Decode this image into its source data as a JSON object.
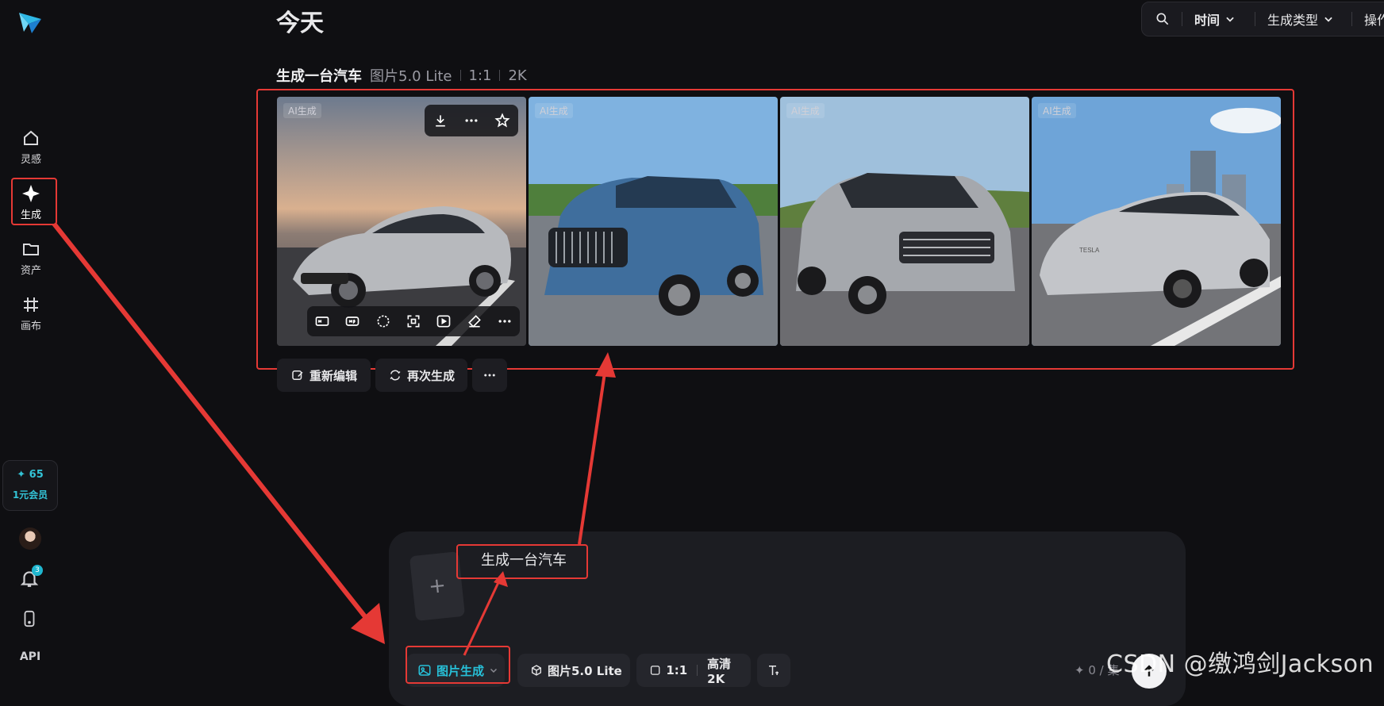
{
  "sidebar": {
    "items": [
      {
        "label": "灵感",
        "icon": "home-icon"
      },
      {
        "label": "生成",
        "icon": "sparkle-icon"
      },
      {
        "label": "资产",
        "icon": "folder-icon"
      },
      {
        "label": "画布",
        "icon": "canvas-icon"
      }
    ],
    "credits": "65",
    "membership": "1元会员",
    "notification_count": "3",
    "api_label": "API"
  },
  "header": {
    "title": "今天",
    "filters": {
      "time": "时间",
      "type": "生成类型",
      "actions": "操作"
    }
  },
  "generation": {
    "prompt": "生成一台汽车",
    "model": "图片5.0 Lite",
    "ratio": "1:1",
    "resolution": "2K",
    "ai_tag": "AI生成",
    "images": [
      {
        "alt": "silver sedan at sunset"
      },
      {
        "alt": "blue SUV on road"
      },
      {
        "alt": "silver SUV on road"
      },
      {
        "alt": "silver Tesla sedan",
        "brand_text": "TESLA"
      }
    ],
    "actions": {
      "reedit": "重新编辑",
      "regenerate": "再次生成"
    }
  },
  "composer": {
    "prompt": "生成一台汽车",
    "mode": "图片生成",
    "model": "图片5.0 Lite",
    "ratio": "1:1",
    "quality": "高清 2K",
    "counter": "0 / 集"
  },
  "watermark": "CSDN @缴鸿剑Jackson",
  "colors": {
    "accent": "#27c0d8",
    "highlight": "#e53935",
    "background": "#0f0f12"
  }
}
